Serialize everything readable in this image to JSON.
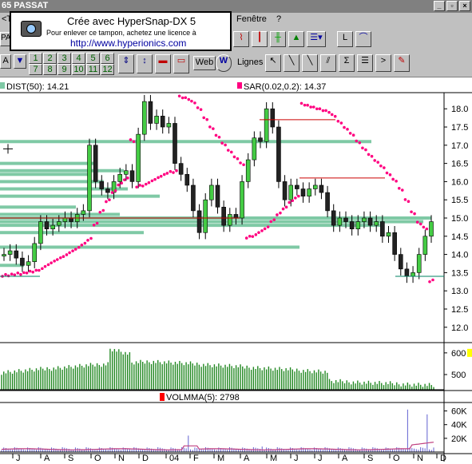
{
  "window": {
    "title": "65  PASSAT"
  },
  "menu": {
    "left": "<Te",
    "fenetre": "Fenêtre",
    "help": "?"
  },
  "toolbar": {
    "left_field": "PASS",
    "ticker_a": "A",
    "web": "Web",
    "lignes": "Lignes",
    "periods": [
      "1",
      "2",
      "3",
      "4",
      "5",
      "6",
      "7",
      "8",
      "9",
      "10",
      "11",
      "12"
    ]
  },
  "watermark": {
    "line1": "Crée avec HyperSnap-DX 5",
    "line2": "Pour enlever ce tampon, achetez une licence à",
    "line3": "http://www.hyperionics.com"
  },
  "indicators": {
    "dist": "DIST(50): 14.21",
    "sar": "SAR(0.02,0.2): 14.37",
    "volmma": "VOLMMA(5):  2798"
  },
  "colors": {
    "candle_up": "#44cc44",
    "candle_dn": "#222222",
    "sar": "#ff0080",
    "profile": "#7fc9a5",
    "volume": "#228822",
    "volmma": "#c04080"
  },
  "chart_data": [
    {
      "type": "line",
      "title": "PASSAT",
      "price_axis": [
        "18.0",
        "17.5",
        "17.0",
        "16.5",
        "16.0",
        "15.5",
        "15.0",
        "14.5",
        "14.0",
        "13.5",
        "13.0",
        "12.5",
        "12.0"
      ],
      "ylim": [
        11.6,
        18.4
      ],
      "x_ticks": [
        "J",
        "A",
        "S",
        "O",
        "N",
        "D",
        "04",
        "F",
        "M",
        "A",
        "M",
        "J",
        "J",
        "A",
        "S",
        "O",
        "N",
        "D"
      ],
      "series": [
        {
          "values": [
            14.0,
            14.1,
            13.9,
            13.7,
            13.8,
            14.3,
            14.9,
            14.7,
            14.8,
            14.9,
            15.0,
            14.9,
            15.1,
            15.2,
            17.0,
            16.0,
            15.8,
            15.7,
            16.0,
            16.2,
            16.3,
            16.0,
            17.3,
            18.2,
            17.6,
            17.8,
            17.5,
            17.6,
            16.5,
            16.2,
            15.9,
            15.2,
            14.6,
            15.5,
            15.9,
            15.3,
            14.8,
            15.1,
            15.0,
            16.0,
            16.6,
            17.2,
            17.1,
            18.0,
            17.5,
            16.0,
            15.5,
            15.9,
            15.8,
            15.6,
            15.8,
            15.9,
            15.7,
            15.2,
            14.8,
            15.0,
            14.9,
            14.7,
            14.9,
            15.0,
            14.8,
            14.9,
            14.5,
            14.6,
            14.0,
            13.6,
            13.4,
            13.5,
            14.0,
            14.5,
            14.9
          ]
        }
      ]
    },
    {
      "type": "bar",
      "yticks": [
        "600",
        "500"
      ],
      "ylim": [
        430,
        640
      ]
    },
    {
      "type": "line",
      "yticks": [
        "60K",
        "40K",
        "20K"
      ],
      "ylim": [
        0,
        70000
      ]
    }
  ]
}
